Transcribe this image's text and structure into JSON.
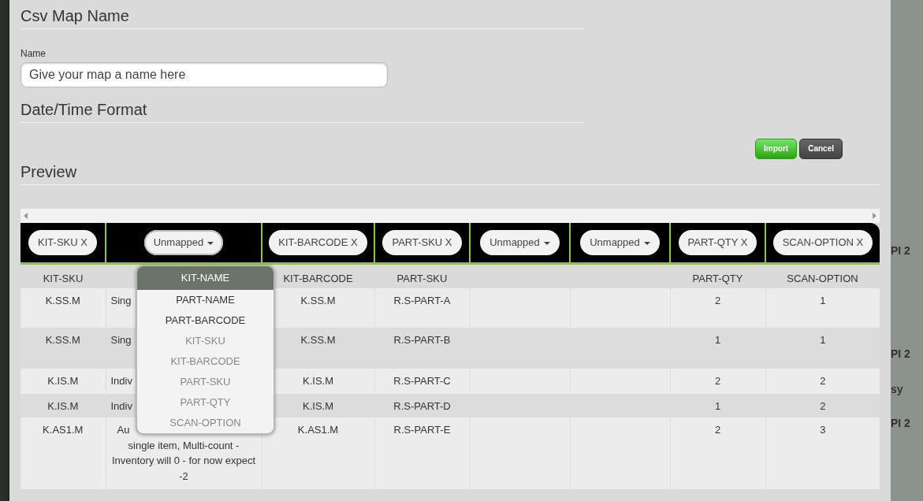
{
  "sections": {
    "map_name_title": "Csv Map Name",
    "name_label": "Name",
    "name_placeholder": "Give your map a name here",
    "date_format_title": "Date/Time Format",
    "preview_title": "Preview"
  },
  "buttons": [
    {
      "label": "Import",
      "kind": "primary"
    },
    {
      "label": "Cancel",
      "kind": "secondary"
    }
  ],
  "table": {
    "mappings": [
      {
        "label": "KIT-SKU X",
        "kind": "mapped",
        "expanded": false
      },
      {
        "label": "Unmapped",
        "kind": "unmapped",
        "expanded": true
      },
      {
        "label": "KIT-BARCODE X",
        "kind": "mapped",
        "expanded": false
      },
      {
        "label": "PART-SKU X",
        "kind": "mapped",
        "expanded": false
      },
      {
        "label": "Unmapped",
        "kind": "unmapped",
        "expanded": false
      },
      {
        "label": "Unmapped",
        "kind": "unmapped",
        "expanded": false
      },
      {
        "label": "PART-QTY X",
        "kind": "mapped",
        "expanded": false
      },
      {
        "label": "SCAN-OPTION X",
        "kind": "mapped",
        "expanded": false
      }
    ],
    "columns": [
      "KIT-SKU",
      "",
      "KIT-BARCODE",
      "PART-SKU",
      "",
      "",
      "PART-QTY",
      "SCAN-OPTION"
    ],
    "rows": [
      [
        "K.SS.M",
        "Sing",
        "K.SS.M",
        "R.S-PART-A",
        "",
        "",
        "2",
        "1"
      ],
      [
        "K.SS.M",
        "Sing",
        "K.SS.M",
        "R.S-PART-B",
        "",
        "",
        "1",
        "1"
      ],
      [
        "K.IS.M",
        "Indiv",
        "K.IS.M",
        "R.S-PART-C",
        "",
        "",
        "2",
        "2"
      ],
      [
        "K.IS.M",
        "Indiv",
        "K.IS.M",
        "R.S-PART-D",
        "",
        "",
        "1",
        "2"
      ],
      [
        "K.AS1.M",
        [
          "Au",
          "single item, Multi-count - Inventory will 0 - for now expect -2"
        ],
        "K.AS1.M",
        "R.S-PART-E",
        "",
        "",
        "2",
        "3"
      ]
    ]
  },
  "mapping_menu": [
    {
      "label": "KIT-NAME",
      "selected": true,
      "disabled": false
    },
    {
      "label": "PART-NAME",
      "selected": false,
      "disabled": false
    },
    {
      "label": "PART-BARCODE",
      "selected": false,
      "disabled": false
    },
    {
      "label": "KIT-SKU",
      "selected": false,
      "disabled": true
    },
    {
      "label": "KIT-BARCODE",
      "selected": false,
      "disabled": true
    },
    {
      "label": "PART-SKU",
      "selected": false,
      "disabled": true
    },
    {
      "label": "PART-QTY",
      "selected": false,
      "disabled": true
    },
    {
      "label": "SCAN-OPTION",
      "selected": false,
      "disabled": true
    }
  ],
  "background_page": {
    "texts": [
      "PI 2",
      "PI 2",
      "sy",
      "PI 2"
    ]
  }
}
